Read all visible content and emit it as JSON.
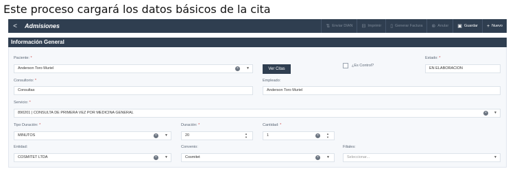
{
  "caption": "Este proceso cargará los datos básicos de la cita",
  "toolbar": {
    "title": "Admisiones",
    "buttons": [
      {
        "label": "Enviar DIAN",
        "icon": "⇅",
        "active": false
      },
      {
        "label": "Imprimir",
        "icon": "⊟",
        "active": false
      },
      {
        "label": "Generar Factura",
        "icon": "▯",
        "active": false
      },
      {
        "label": "Anular",
        "icon": "⊗",
        "active": false
      },
      {
        "label": "Guardar",
        "icon": "▣",
        "active": true
      },
      {
        "label": "Nuevo",
        "icon": "+",
        "active": true
      }
    ]
  },
  "section": {
    "title": "Información General"
  },
  "form": {
    "paciente": {
      "label": "Paciente:",
      "value": "Anderson Toro Muriel"
    },
    "ver_citas": "Ver Citas",
    "es_control": "¿Es Control?",
    "estado": {
      "label": "Estado:",
      "value": "EN ELABORACION"
    },
    "consultorio": {
      "label": "Consultorio:",
      "value": "Consultas"
    },
    "empleado": {
      "label": "Empleado:",
      "value": "Anderson  Toro Muriel"
    },
    "servicio": {
      "label": "Servicio:",
      "value": "890201 | CONSULTA DE PRIMERA VEZ POR MEDICINA GENERAL"
    },
    "tipo_duracion": {
      "label": "Tipo Duración:",
      "value": "MINUTOS"
    },
    "duracion": {
      "label": "Duración:",
      "value": "20"
    },
    "cantidad": {
      "label": "Cantidad:",
      "value": "1"
    },
    "entidad": {
      "label": "Entidad:",
      "value": "COSMITET LTDA"
    },
    "convenio": {
      "label": "Convenio:",
      "value": "Cosmitet"
    },
    "filiales": {
      "label": "Filiales:",
      "placeholder": "Seleccionar..."
    }
  },
  "required_mark": "*"
}
